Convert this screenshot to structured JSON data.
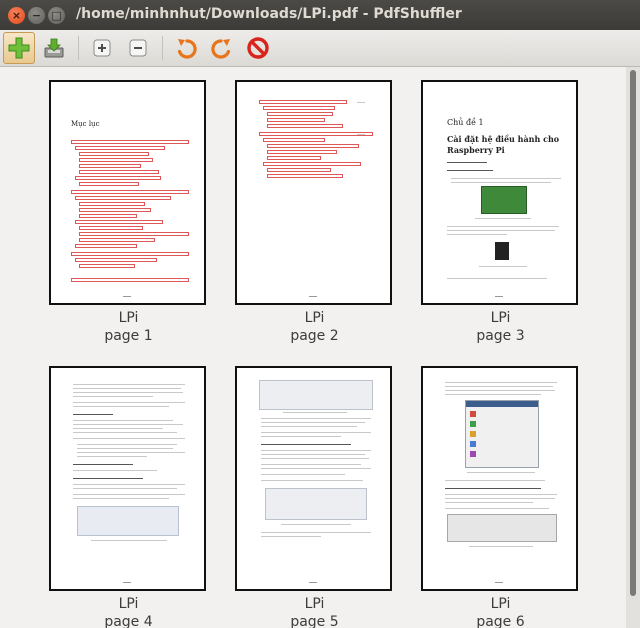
{
  "window": {
    "title": "/home/minhnhut/Downloads/LPi.pdf - PdfShuffler",
    "close_glyph": "×",
    "minimize_glyph": "−",
    "maximize_glyph": "□"
  },
  "toolbar": {
    "buttons": [
      {
        "name": "add-file-button",
        "icon": "green-plus-icon"
      },
      {
        "name": "export-button",
        "icon": "save-download-icon"
      },
      {
        "name": "zoom-in-button",
        "icon": "zoom-in-icon"
      },
      {
        "name": "zoom-out-button",
        "icon": "zoom-out-icon"
      },
      {
        "name": "rotate-left-button",
        "icon": "rotate-left-icon"
      },
      {
        "name": "rotate-right-button",
        "icon": "rotate-right-icon"
      },
      {
        "name": "delete-button",
        "icon": "delete-icon"
      }
    ]
  },
  "pages": [
    {
      "filename": "LPi",
      "label": "page 1",
      "heading": "Mục lục"
    },
    {
      "filename": "LPi",
      "label": "page 2"
    },
    {
      "filename": "LPi",
      "label": "page 3",
      "chapter": "Chủ đề 1",
      "heading": "Cài đặt hệ điều hành cho Raspberry Pi"
    },
    {
      "filename": "LPi",
      "label": "page 4"
    },
    {
      "filename": "LPi",
      "label": "page 5"
    },
    {
      "filename": "LPi",
      "label": "page 6"
    }
  ],
  "colors": {
    "titlebar": "#3c3b37",
    "toc_link_box": "#e05757",
    "active_button": "#e9c98f"
  }
}
